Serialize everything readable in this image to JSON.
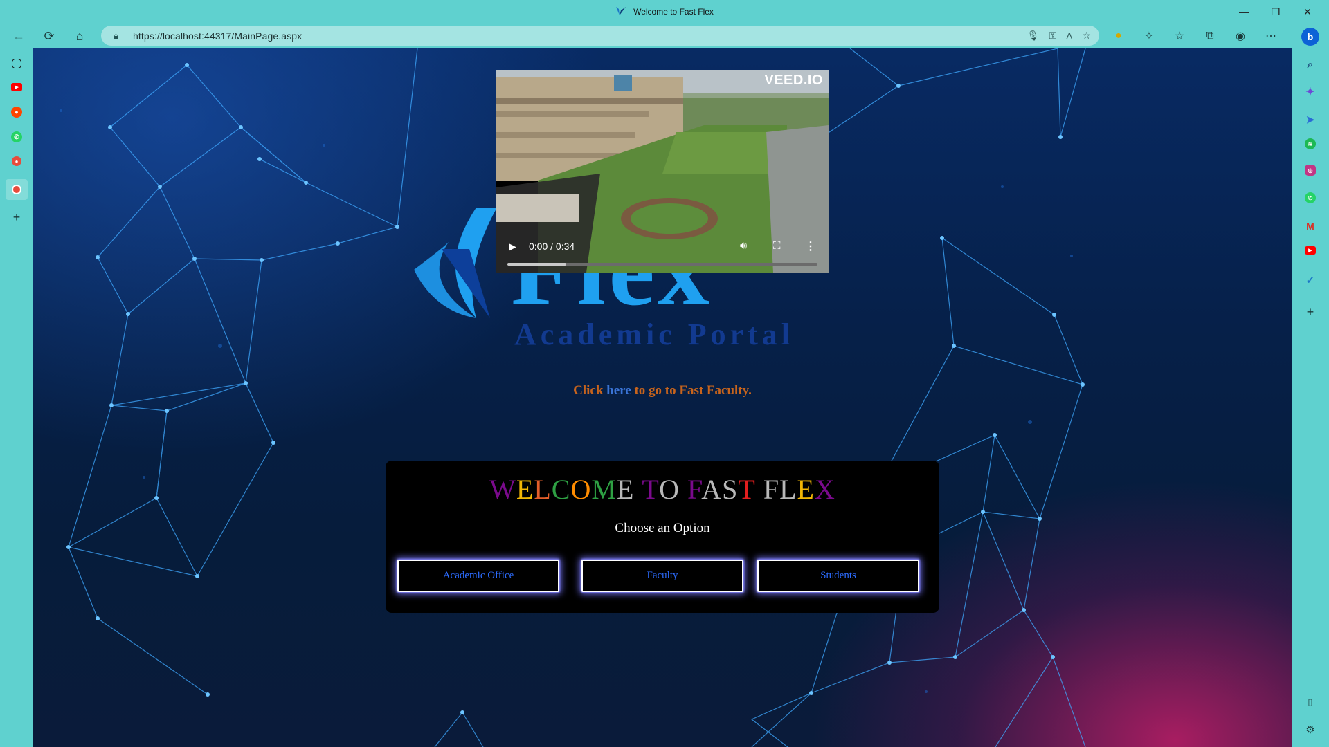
{
  "browser": {
    "window_title": "Welcome to Fast Flex",
    "url_prefix": "https://",
    "url_host": "localhost",
    "url_rest": ":44317/MainPage.aspx"
  },
  "video": {
    "watermark": "VEED.IO",
    "time": "0:00 / 0:34",
    "progress": 0.19
  },
  "logo": {
    "title": "Flex",
    "subtitle": "Academic Portal"
  },
  "nav_link": {
    "prefix": "Click ",
    "link": "here",
    "suffix": " to go to Fast Faculty."
  },
  "panel": {
    "welcome_letters": [
      {
        "ch": "W",
        "color": "#7a0a8c"
      },
      {
        "ch": "E",
        "color": "#f2b705"
      },
      {
        "ch": "L",
        "color": "#e35e2a"
      },
      {
        "ch": "C",
        "color": "#2ea043"
      },
      {
        "ch": "O",
        "color": "#ff8c00"
      },
      {
        "ch": "M",
        "color": "#2ea043"
      },
      {
        "ch": "E",
        "color": "#b8b8b8"
      },
      {
        "ch": " ",
        "color": "#ffffff"
      },
      {
        "ch": "T",
        "color": "#7a0a8c"
      },
      {
        "ch": "O",
        "color": "#b8b8b8"
      },
      {
        "ch": " ",
        "color": "#ffffff"
      },
      {
        "ch": "F",
        "color": "#7a0a8c"
      },
      {
        "ch": "A",
        "color": "#b8b8b8"
      },
      {
        "ch": "S",
        "color": "#b8b8b8"
      },
      {
        "ch": "T",
        "color": "#e31e1e"
      },
      {
        "ch": " ",
        "color": "#ffffff"
      },
      {
        "ch": "F",
        "color": "#b8b8b8"
      },
      {
        "ch": "L",
        "color": "#b8b8b8"
      },
      {
        "ch": "E",
        "color": "#f2b705"
      },
      {
        "ch": "X",
        "color": "#7a0a8c"
      }
    ],
    "choose_label": "Choose an Option",
    "options": [
      "Academic Office",
      "Faculty",
      "Students"
    ]
  },
  "colors": {
    "frame": "#5fd1cf",
    "link_orange": "#c7641d",
    "link_blue": "#3a74d6",
    "button_text": "#2c6cff"
  }
}
